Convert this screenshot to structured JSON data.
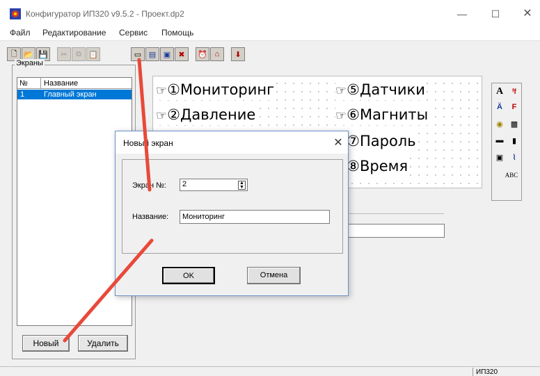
{
  "window": {
    "title": "Конфигуратор ИП320 v9.5.2 - Проект.dp2",
    "minimize_glyph": "—",
    "maximize_glyph": "☐",
    "close_glyph": "✕"
  },
  "menu": {
    "items": [
      {
        "label": "Файл"
      },
      {
        "label": "Редактирование"
      },
      {
        "label": "Сервис"
      },
      {
        "label": "Помощь"
      }
    ]
  },
  "toolbar": {
    "icons": [
      "new-file-icon",
      "open-folder-icon",
      "save-icon",
      "cut-icon",
      "copy-icon",
      "paste-icon",
      "new-screen-icon",
      "screen-properties-icon",
      "screen-copy-icon",
      "delete-screen-icon",
      "alarm-icon",
      "home-icon",
      "download-icon"
    ]
  },
  "screens_panel": {
    "title": "Экраны",
    "columns": [
      "№",
      "Название"
    ],
    "rows": [
      {
        "n": "1",
        "name": "Главный экран",
        "selected": true
      }
    ],
    "new_button": "Новый",
    "delete_button": "Удалить"
  },
  "preview": {
    "items": [
      {
        "hand": "☞",
        "num": "①",
        "text": "Мониторинг"
      },
      {
        "hand": "☞",
        "num": "②",
        "text": "Давление"
      },
      {
        "hand": "☞",
        "num": "⑤",
        "text": "Датчики"
      },
      {
        "hand": "☞",
        "num": "⑥",
        "text": "Магниты"
      },
      {
        "hand": "☞",
        "num": "⑦",
        "text": "Пароль"
      },
      {
        "hand": "☞",
        "num": "⑧",
        "text": "Время"
      }
    ]
  },
  "right_tools": {
    "icons": [
      "text-tool-icon",
      "formula-tool-icon",
      "variable-text-icon",
      "bitmap-text-icon",
      "lamp-icon",
      "image-icon",
      "indicator-icon",
      "bar-icon",
      "button-icon",
      "graph-icon",
      "abc-tool-icon"
    ],
    "text_a": "A",
    "text_abc": "ABC"
  },
  "status": {
    "device": "ИП320"
  },
  "dialog": {
    "title": "Новый экран",
    "close_glyph": "✕",
    "screen_no_label": "Экран №:",
    "screen_no_value": "2",
    "name_label": "Название:",
    "name_value": "Мониторинг",
    "ok_label": "OK",
    "cancel_label": "Отмена"
  },
  "colors": {
    "selection": "#0078d7",
    "annotation": "#e8493a"
  }
}
